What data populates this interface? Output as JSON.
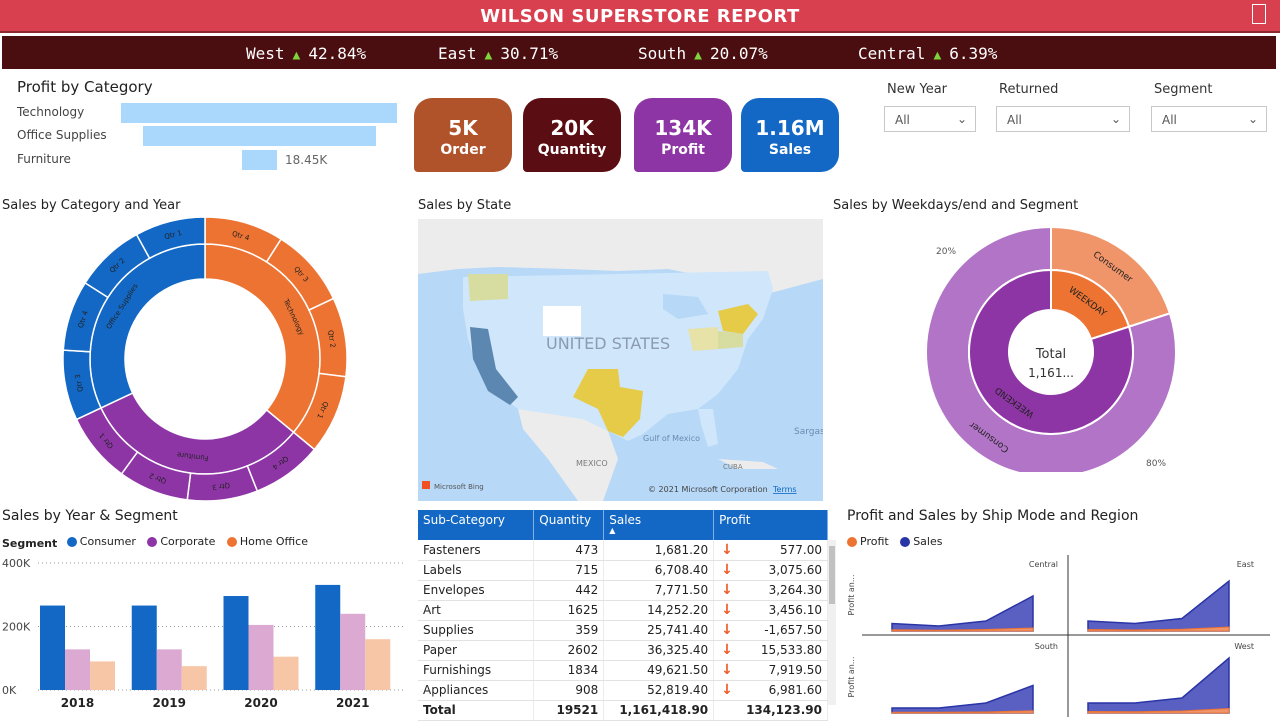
{
  "header": {
    "title": "WILSON SUPERSTORE REPORT"
  },
  "regions": [
    {
      "name": "West",
      "value": "42.84%"
    },
    {
      "name": "East",
      "value": "30.71%"
    },
    {
      "name": "South",
      "value": "20.07%"
    },
    {
      "name": "Central",
      "value": "6.39%"
    }
  ],
  "profit_by_category": {
    "title": "Profit by Category",
    "items": [
      {
        "label": "Technology",
        "value": 145
      },
      {
        "label": "Office Supplies",
        "value": 122
      },
      {
        "label": "Furniture",
        "value": 18.45,
        "data_label": "18.45K"
      }
    ]
  },
  "kpis": [
    {
      "value": "5K",
      "label": "Order",
      "color": "#b0532a"
    },
    {
      "value": "20K",
      "label": "Quantity",
      "color": "#5a0d12"
    },
    {
      "value": "134K",
      "label": "Profit",
      "color": "#8e35a6"
    },
    {
      "value": "1.16M",
      "label": "Sales",
      "color": "#1268c4"
    }
  ],
  "slicers": [
    {
      "label": "New Year",
      "value": "All"
    },
    {
      "label": "Returned",
      "value": "All"
    },
    {
      "label": "Segment",
      "value": "All"
    }
  ],
  "sunburst": {
    "title": "Sales by Category and Year",
    "inner": [
      {
        "label": "Technology",
        "share": 0.36,
        "color": "#ed7332"
      },
      {
        "label": "Furniture",
        "share": 0.32,
        "color": "#8e35a6"
      },
      {
        "label": "Office Supplies",
        "share": 0.32,
        "color": "#1268c4"
      }
    ],
    "outer_labels": [
      "Qtr 4",
      "Qtr 3",
      "Qtr 2",
      "Qtr 1",
      "Qtr 4",
      "Qtr 3",
      "Qtr 2",
      "Qtr 1",
      "Qtr 3",
      "Qtr 4",
      "Qtr 2",
      "Qtr 1"
    ]
  },
  "map": {
    "title": "Sales by State",
    "country_label": "UNITED STATES",
    "labels": [
      "Gulf of Mexico",
      "MEXICO",
      "CUBA",
      "Sargas"
    ],
    "attribution": "Microsoft Bing",
    "copyright": "© 2021 Microsoft Corporation",
    "terms": "Terms"
  },
  "weekday": {
    "title": "Sales by Weekdays/end and Segment",
    "center_label": "Total",
    "center_value": "1,161...",
    "inner": [
      {
        "label": "WEEKDAY",
        "share": 0.2,
        "color": "#ed7332"
      },
      {
        "label": "WEEKEND",
        "share": 0.8,
        "color": "#8e35a6"
      }
    ],
    "outer": [
      {
        "label": "Consumer",
        "share": 0.2,
        "pct": "20%",
        "color": "#f0946a"
      },
      {
        "label": "Consumer",
        "share": 0.8,
        "pct": "80%",
        "color": "#b274c6"
      }
    ]
  },
  "year_segment": {
    "title": "Sales by Year & Segment",
    "legend_title": "Segment",
    "chart_data": {
      "type": "bar",
      "categories": [
        "2018",
        "2019",
        "2020",
        "2021"
      ],
      "series": [
        {
          "name": "Consumer",
          "color": "#1268c4",
          "values": [
            266000,
            266000,
            296000,
            331000
          ]
        },
        {
          "name": "Corporate",
          "color": "#dca9d2",
          "values": [
            128000,
            128000,
            205000,
            240000
          ]
        },
        {
          "name": "Home Office",
          "color": "#f7c6a7",
          "values": [
            90000,
            75000,
            105000,
            160000
          ]
        }
      ],
      "yticks": [
        "400K",
        "200K",
        "0K"
      ],
      "ylim": [
        0,
        400000
      ]
    }
  },
  "table": {
    "headers": [
      "Sub-Category",
      "Quantity",
      "Sales",
      "Profit"
    ],
    "rows": [
      [
        "Fasteners",
        "473",
        "1,681.20",
        "577.00"
      ],
      [
        "Labels",
        "715",
        "6,708.40",
        "3,075.60"
      ],
      [
        "Envelopes",
        "442",
        "7,771.50",
        "3,264.30"
      ],
      [
        "Art",
        "1625",
        "14,252.20",
        "3,456.10"
      ],
      [
        "Supplies",
        "359",
        "25,741.40",
        "-1,657.50"
      ],
      [
        "Paper",
        "2602",
        "36,325.40",
        "15,533.80"
      ],
      [
        "Furnishings",
        "1834",
        "49,621.50",
        "7,919.50"
      ],
      [
        "Appliances",
        "908",
        "52,819.40",
        "6,981.60"
      ]
    ],
    "total": [
      "Total",
      "19521",
      "1,161,418.90",
      "134,123.90"
    ]
  },
  "shipmode": {
    "title": "Profit and Sales by Ship Mode and Region",
    "legend": [
      {
        "name": "Profit",
        "color": "#ed7332"
      },
      {
        "name": "Sales",
        "color": "#2934a6"
      }
    ],
    "yaxis_label": "Profit an...",
    "panels": [
      {
        "region": "Central",
        "sales": [
          3,
          2,
          4,
          14
        ],
        "profit": [
          0.5,
          0.3,
          0.6,
          1.2
        ]
      },
      {
        "region": "East",
        "sales": [
          4,
          3,
          5,
          20
        ],
        "profit": [
          0.6,
          0.4,
          0.7,
          1.6
        ]
      },
      {
        "region": "South",
        "sales": [
          2,
          2,
          4,
          11
        ],
        "profit": [
          0.3,
          0.3,
          0.4,
          0.9
        ]
      },
      {
        "region": "West",
        "sales": [
          4,
          4,
          6,
          22
        ],
        "profit": [
          0.6,
          0.5,
          0.8,
          1.8
        ]
      }
    ]
  }
}
